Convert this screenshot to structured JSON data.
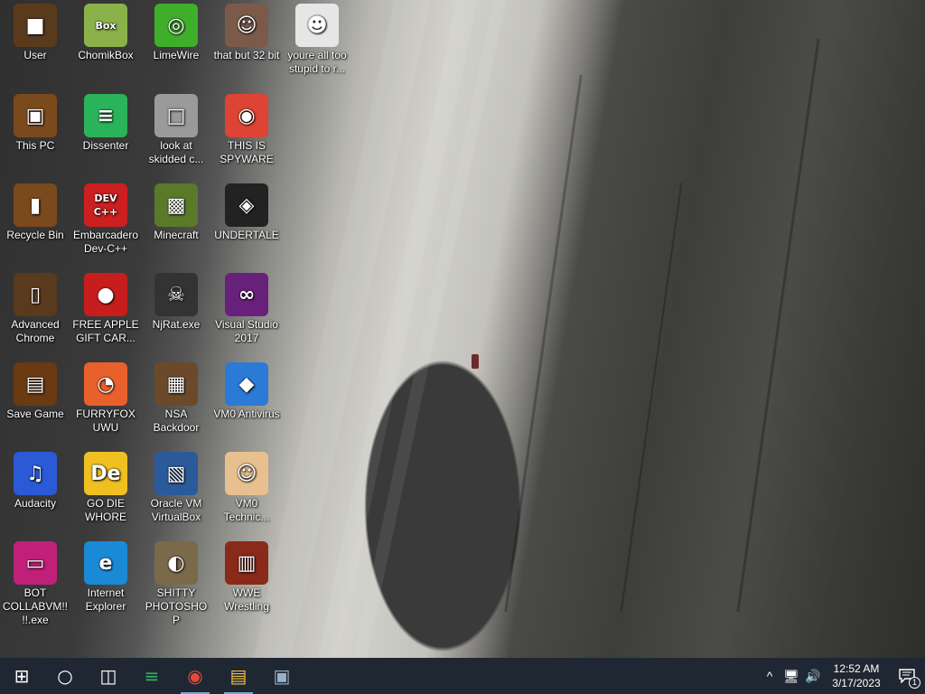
{
  "desktop_icons": [
    {
      "label": "User",
      "icon": "user-folder-icon",
      "bg": "#5a3a1c",
      "glyph": "■"
    },
    {
      "label": "ChomikBox",
      "icon": "chomikbox-icon",
      "bg": "#8ab14a",
      "glyph": "Box"
    },
    {
      "label": "LimeWire",
      "icon": "limewire-icon",
      "bg": "#3fae2a",
      "glyph": "◎"
    },
    {
      "label": "that but 32 bit",
      "icon": "portrait-icon",
      "bg": "#7b5a4a",
      "glyph": "☺"
    },
    {
      "label": "youre all too stupid to r...",
      "icon": "bw-portrait-icon",
      "bg": "#e6e6e6",
      "glyph": "☻"
    },
    {
      "label": "This PC",
      "icon": "this-pc-icon",
      "bg": "#7a4a1c",
      "glyph": "▣"
    },
    {
      "label": "Dissenter",
      "icon": "dissenter-icon",
      "bg": "#2bb35a",
      "glyph": "≡"
    },
    {
      "label": "look at skidded c...",
      "icon": "files-icon",
      "bg": "#9a9a9a",
      "glyph": "□"
    },
    {
      "label": "THIS IS SPYWARE",
      "icon": "chrome-icon",
      "bg": "#dd4433",
      "glyph": "◉"
    },
    {
      "label": "Recycle Bin",
      "icon": "recycle-bin-icon",
      "bg": "#7a4a1c",
      "glyph": "▮"
    },
    {
      "label": "Embarcadero Dev-C++",
      "icon": "devcpp-icon",
      "bg": "#cc1f1f",
      "glyph": "DEV C++"
    },
    {
      "label": "Minecraft",
      "icon": "minecraft-icon",
      "bg": "#5a7a2a",
      "glyph": "▩"
    },
    {
      "label": "UNDERTALE",
      "icon": "unity-icon",
      "bg": "#222222",
      "glyph": "◈"
    },
    {
      "label": "Advanced Chrome",
      "icon": "wardrobe-icon",
      "bg": "#5a3a1c",
      "glyph": "▯"
    },
    {
      "label": "FREE APPLE GIFT CAR...",
      "icon": "apple-icon",
      "bg": "#c81d1d",
      "glyph": "●"
    },
    {
      "label": "NjRat.exe",
      "icon": "skull-icon",
      "bg": "#333333",
      "glyph": "☠"
    },
    {
      "label": "Visual Studio 2017",
      "icon": "visual-studio-icon",
      "bg": "#68217a",
      "glyph": "∞"
    },
    {
      "label": "Save Game",
      "icon": "save-game-icon",
      "bg": "#6a3a12",
      "glyph": "▤"
    },
    {
      "label": "FURRYFOX UWU",
      "icon": "firefox-icon",
      "bg": "#e8602c",
      "glyph": "◔"
    },
    {
      "label": "NSA Backdoor",
      "icon": "nsa-icon",
      "bg": "#6a4a2a",
      "glyph": "▦"
    },
    {
      "label": "VM0 Antivirus",
      "icon": "shield-icon",
      "bg": "#2a7ad6",
      "glyph": "◆"
    },
    {
      "label": "Audacity",
      "icon": "audacity-icon",
      "bg": "#2a5ad6",
      "glyph": "♫"
    },
    {
      "label": "GO DIE WHORE",
      "icon": "de-icon",
      "bg": "#f0c020",
      "glyph": "De"
    },
    {
      "label": "Oracle VM VirtualBox",
      "icon": "virtualbox-icon",
      "bg": "#2a5a9a",
      "glyph": "▧"
    },
    {
      "label": "VM0 Technic...",
      "icon": "technician-icon",
      "bg": "#e8c090",
      "glyph": "☺"
    },
    {
      "label": "BOT COLLABVM!!!!.exe",
      "icon": "monitor-icon",
      "bg": "#c0207a",
      "glyph": "▭"
    },
    {
      "label": "Internet Explorer",
      "icon": "edge-icon",
      "bg": "#1a8ad6",
      "glyph": "e"
    },
    {
      "label": "SHITTY PHOTOSHOP",
      "icon": "gimp-icon",
      "bg": "#7a6a4a",
      "glyph": "◐"
    },
    {
      "label": "WWE Wrestling",
      "icon": "wwe-icon",
      "bg": "#8a2a1a",
      "glyph": "▥"
    }
  ],
  "taskbar": {
    "buttons": [
      {
        "name": "start-button",
        "icon": "windows-icon",
        "glyph": "⊞"
      },
      {
        "name": "search-button",
        "icon": "cortana-icon",
        "glyph": "○"
      },
      {
        "name": "task-view-button",
        "icon": "task-view-icon",
        "glyph": "◫"
      },
      {
        "name": "dissenter-taskbar-button",
        "icon": "dissenter-icon",
        "glyph": "≡"
      },
      {
        "name": "chrome-taskbar-button",
        "icon": "chrome-icon",
        "glyph": "◉"
      },
      {
        "name": "file-explorer-button",
        "icon": "folder-icon",
        "glyph": "▤"
      },
      {
        "name": "app-taskbar-button",
        "icon": "app-icon",
        "glyph": "▣"
      }
    ],
    "tray": {
      "chevron": "^",
      "time": "12:52 AM",
      "date": "3/17/2023",
      "notification_count": "1"
    }
  }
}
